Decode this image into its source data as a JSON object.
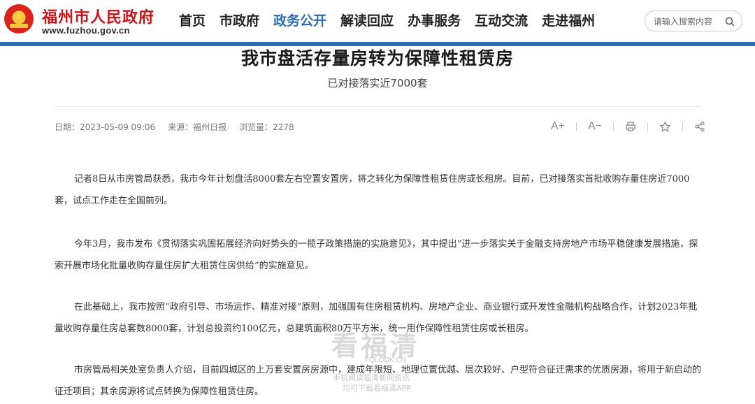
{
  "header": {
    "site_title": "福州市人民政府",
    "site_url": "www.fuzhou.gov.cn",
    "nav": [
      {
        "label": "首页",
        "active": false
      },
      {
        "label": "市政府",
        "active": false
      },
      {
        "label": "政务公开",
        "active": true
      },
      {
        "label": "解读回应",
        "active": false
      },
      {
        "label": "办事服务",
        "active": false
      },
      {
        "label": "互动交流",
        "active": false
      },
      {
        "label": "走进福州",
        "active": false
      }
    ],
    "search_placeholder": "请输入搜索内容"
  },
  "article": {
    "title": "我市盘活存量房转为保障性租赁房",
    "subtitle": "已对接落实近7000套",
    "meta": {
      "date": "日期：2023-05-09 09:06",
      "source": "来源：福州日报",
      "views": "浏览量：2278"
    },
    "tools": {
      "font_increase": "A+",
      "font_decrease": "A−"
    },
    "paragraphs": [
      "记者8日从市房管局获悉，我市今年计划盘活8000套左右空置安置房，将之转化为保障性租赁住房或长租房。目前，已对接落实首批收购存量住房近7000套，试点工作走在全国前列。",
      "今年3月，我市发布《贯彻落实巩固拓展经济向好势头的一揽子政策措施的实施意见》，其中提出“进一步落实关于金融支持房地产市场平稳健康发展措施，探索开展市场化批量收购存量住房扩大租赁住房供给”的实施意见。",
      "在此基础上，我市按照“政府引导、市场运作、精准对接”原则，加强国有住房租赁机构、房地产企业、商业银行或开发性金融机构战略合作，计划2023年批量收购存量住房总套数8000套，计划总投资约100亿元，总建筑面积80万平方米，统一用作保障性租赁住房或长租房。",
      "市房管局相关处室负责人介绍，目前四城区的上万套安置房房源中，建成年限短、地理位置优越、层次较好、户型符合征迁需求的优质房源，将用于新启动的征迁项目；其余房源将试点转换为保障性租赁住房。"
    ]
  },
  "watermark": {
    "big": "看福清",
    "url": "FQLOOK.CN",
    "line1": "手机阅读福清新闻资讯",
    "line2": "均可下载看福清APP"
  },
  "colors": {
    "brand_red": "#c8161d",
    "nav_active": "#2d6bb3",
    "header_bar": "#2d6bb3"
  }
}
